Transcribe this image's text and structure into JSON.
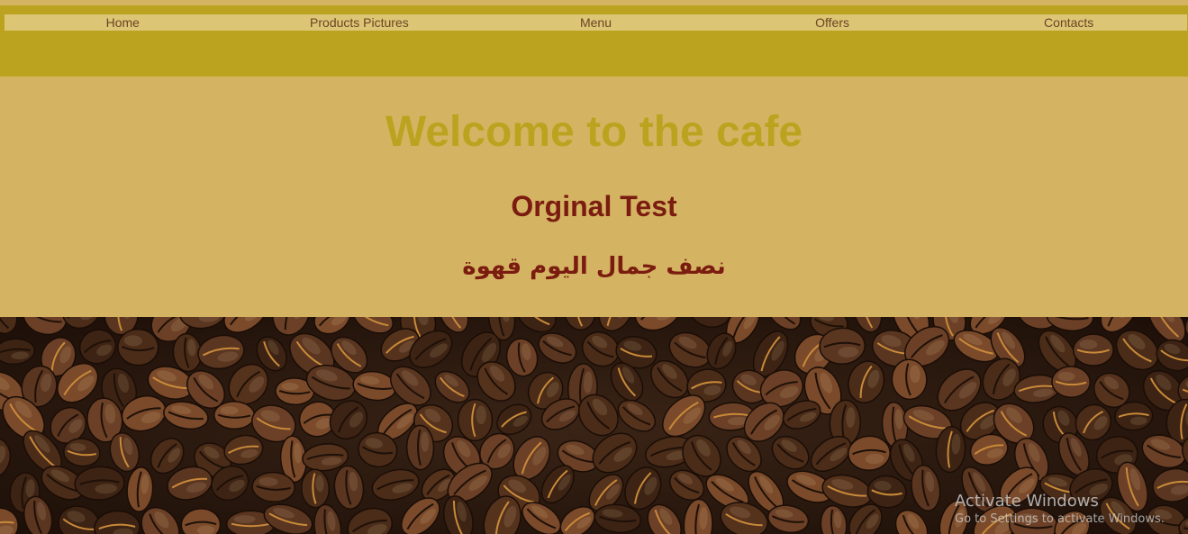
{
  "nav": {
    "items": [
      {
        "label": "Home"
      },
      {
        "label": "Products Pictures"
      },
      {
        "label": "Menu"
      },
      {
        "label": "Offers"
      },
      {
        "label": "Contacts"
      }
    ]
  },
  "hero": {
    "title": "Welcome to the cafe",
    "subtitle": "Orginal Test",
    "arabic_text": "نصف جمال اليوم قهوة"
  },
  "banner": {
    "image": "coffee-beans-photo"
  },
  "windows_watermark": {
    "title": "Activate Windows",
    "subtitle": "Go to Settings to activate Windows."
  },
  "colors": {
    "header_bg": "#bca31f",
    "nav_bg": "#dcc676",
    "page_bg": "#d4b462",
    "title": "#bca31f",
    "subtitle": "#7b1c10",
    "nav_text": "#6b4423"
  }
}
